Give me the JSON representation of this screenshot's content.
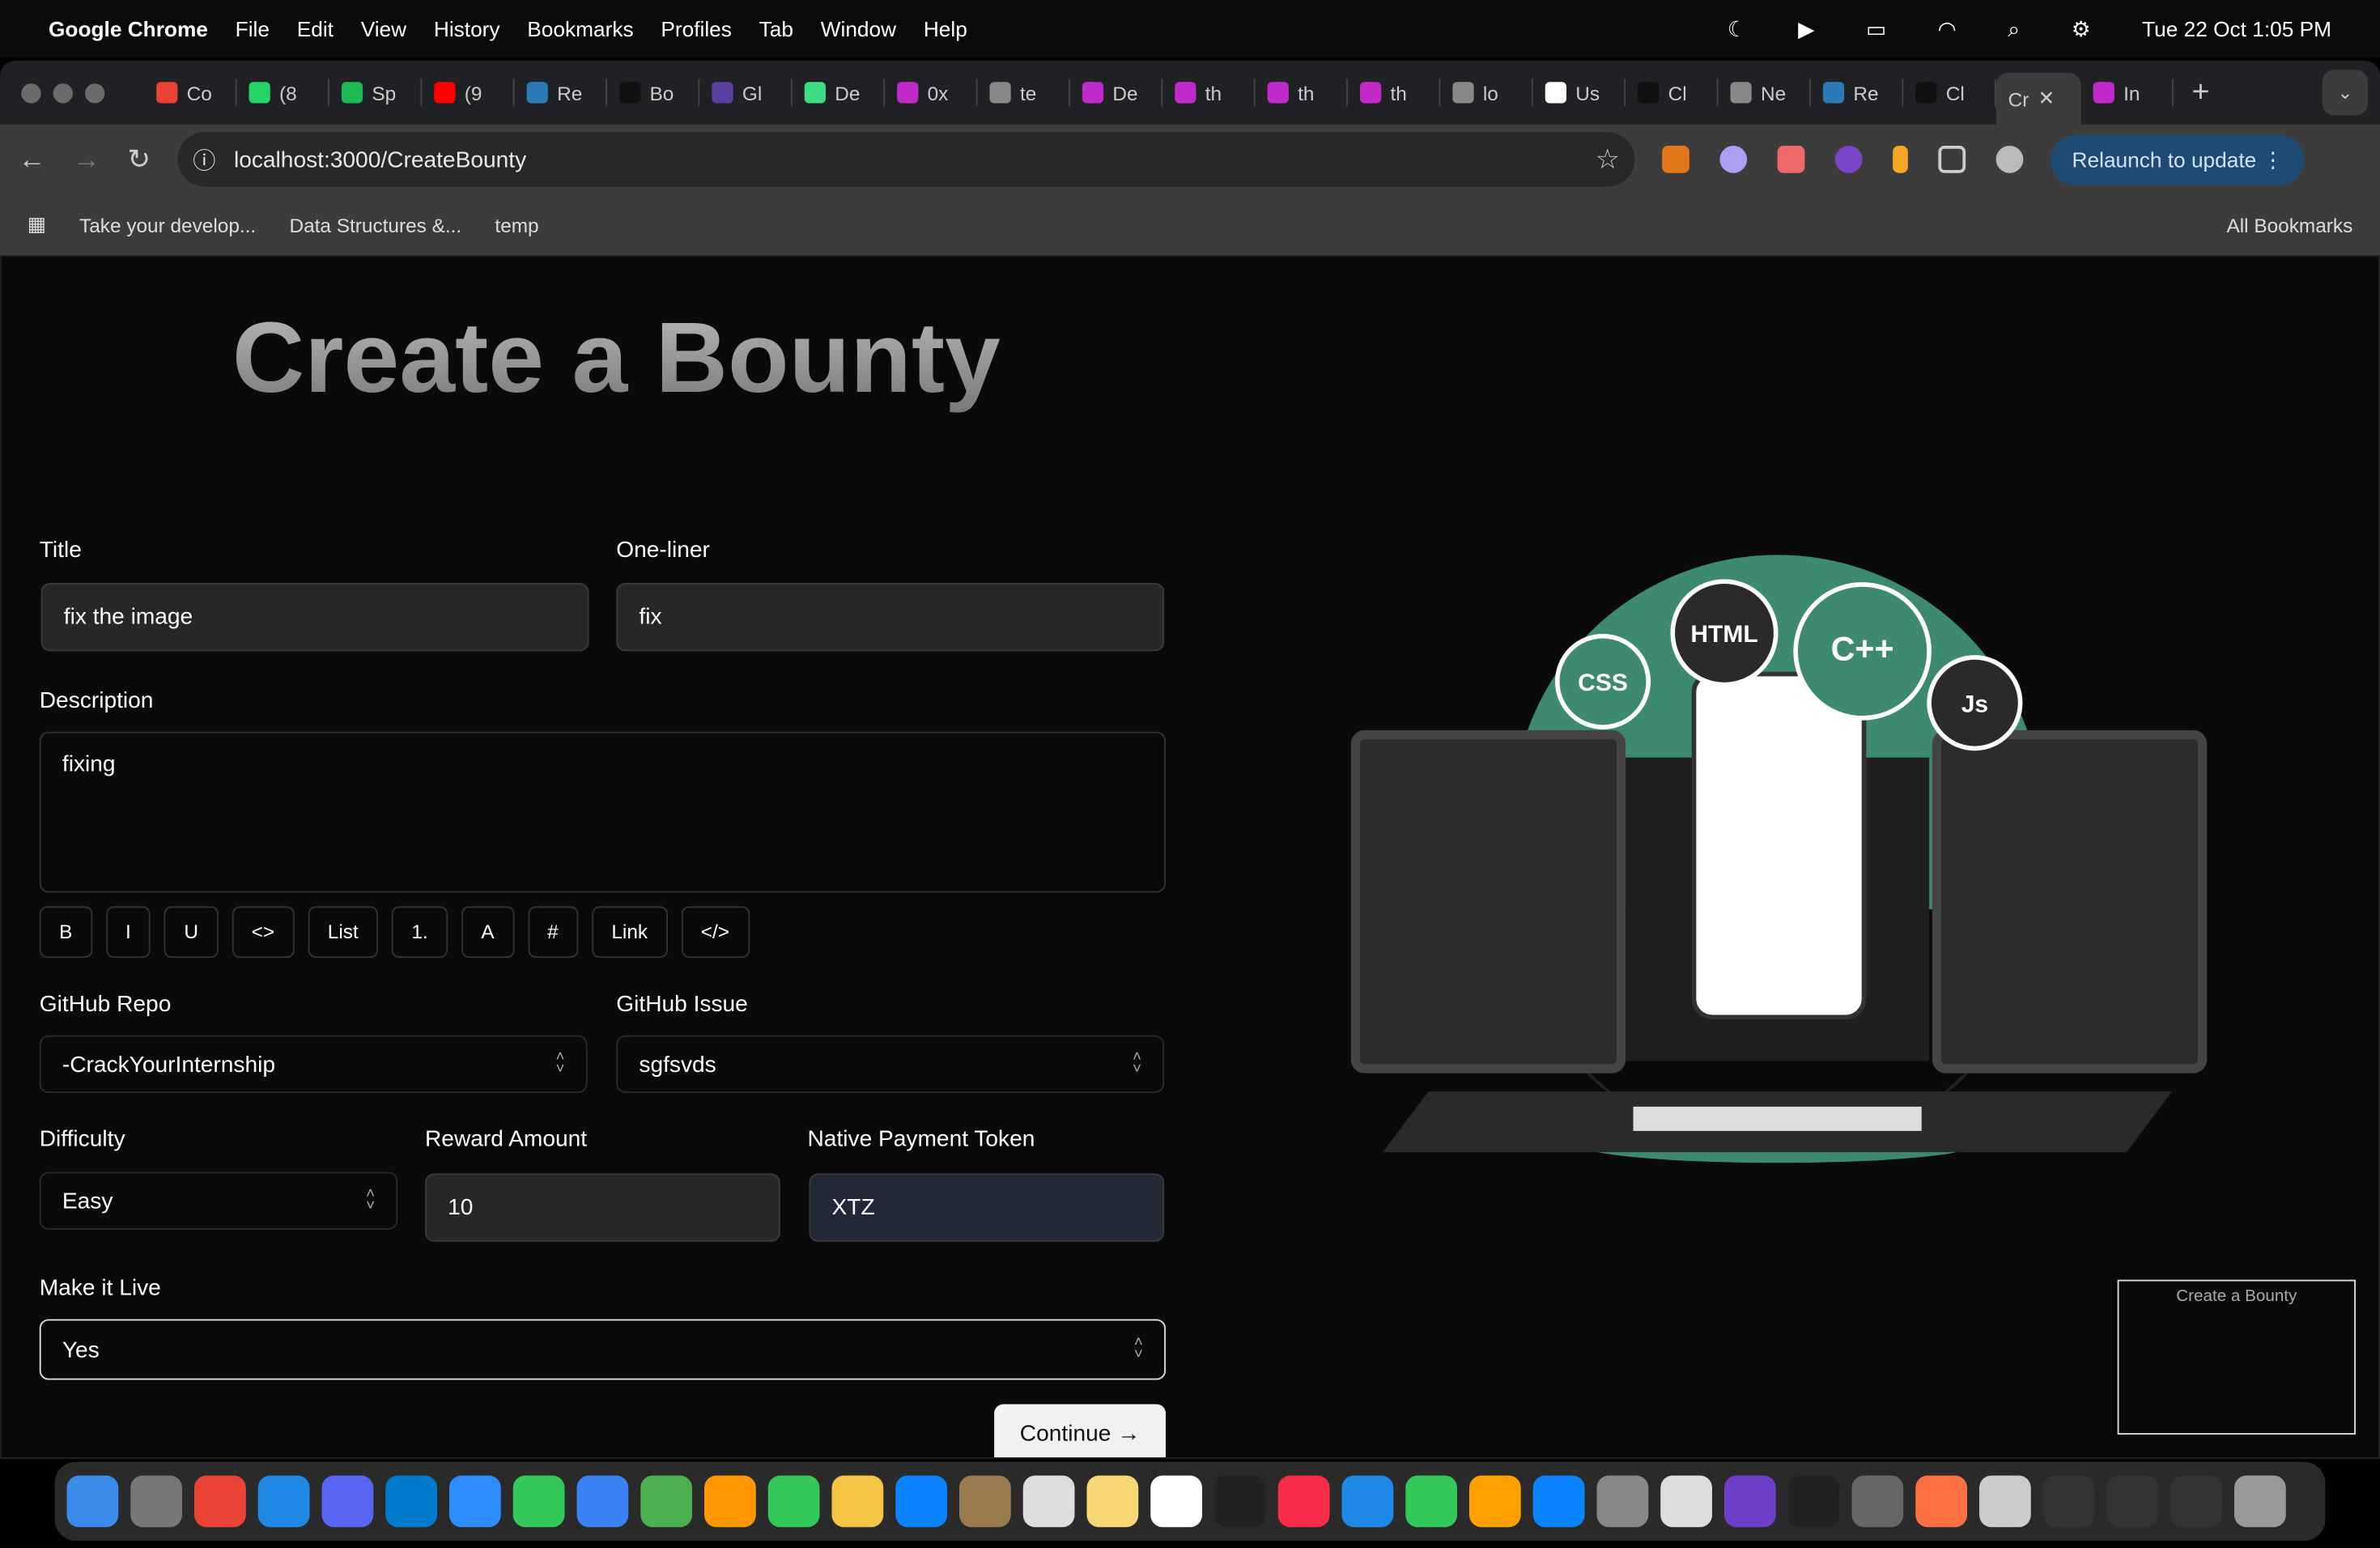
{
  "menubar": {
    "app": "Google Chrome",
    "items": [
      "File",
      "Edit",
      "View",
      "History",
      "Bookmarks",
      "Profiles",
      "Tab",
      "Window",
      "Help"
    ],
    "clock": "Tue 22 Oct  1:05 PM"
  },
  "tabs": [
    {
      "t": "Co",
      "c": "#ea4335"
    },
    {
      "t": "(8",
      "c": "#25d366"
    },
    {
      "t": "Sp",
      "c": "#1db954"
    },
    {
      "t": "(9",
      "c": "#ff0000"
    },
    {
      "t": "Re",
      "c": "#2a7ab5"
    },
    {
      "t": "Bo",
      "c": "#111"
    },
    {
      "t": "Gl",
      "c": "#5b3fa0"
    },
    {
      "t": "De",
      "c": "#3ddc84"
    },
    {
      "t": "0x",
      "c": "#c02ac9"
    },
    {
      "t": "te",
      "c": "#888"
    },
    {
      "t": "De",
      "c": "#c02ac9"
    },
    {
      "t": "th",
      "c": "#c02ac9"
    },
    {
      "t": "th",
      "c": "#c02ac9"
    },
    {
      "t": "th",
      "c": "#c02ac9"
    },
    {
      "t": "lo",
      "c": "#888"
    },
    {
      "t": "Us",
      "c": "#fff"
    },
    {
      "t": "Cl",
      "c": "#111"
    },
    {
      "t": "Ne",
      "c": "#888"
    },
    {
      "t": "Re",
      "c": "#2a7ab5"
    },
    {
      "t": "Cl",
      "c": "#111"
    }
  ],
  "active_tab": "Cr",
  "last_tab": "In",
  "url": "localhost:3000/CreateBounty",
  "relaunch": "Relaunch to update",
  "bookmarks": [
    "Take your develop...",
    "Data Structures &...",
    "temp"
  ],
  "all_bookmarks": "All Bookmarks",
  "form": {
    "heading": "Create a Bounty",
    "title_label": "Title",
    "title_value": "fix the image",
    "oneliner_label": "One-liner",
    "oneliner_value": "fix",
    "description_label": "Description",
    "description_value": "fixing",
    "format_buttons": [
      "B",
      "I",
      "U",
      "<>",
      "List",
      "1.",
      "A",
      "#",
      "Link",
      "</>"
    ],
    "repo_label": "GitHub Repo",
    "repo_value": "-CrackYourInternship",
    "issue_label": "GitHub Issue",
    "issue_value": "sgfsvds",
    "difficulty_label": "Difficulty",
    "difficulty_value": "Easy",
    "reward_label": "Reward Amount",
    "reward_value": "10",
    "token_label": "Native Payment Token",
    "token_value": "XTZ",
    "live_label": "Make it Live",
    "live_value": "Yes",
    "continue": "Continue →"
  },
  "illustration": {
    "badges": [
      "CSS",
      "HTML",
      "C++",
      "Js"
    ],
    "accent": "#3d8a6e"
  },
  "dock_colors": [
    "#3b8bea",
    "#777",
    "#ea4335",
    "#1e88e5",
    "#5865f2",
    "#007acc",
    "#2d8cff",
    "#34c759",
    "#3b82f6",
    "#4caf50",
    "#ff9800",
    "#34c759",
    "#f4c542",
    "#0a84ff",
    "#9a7b4f",
    "#ddd",
    "#f7d774",
    "#ffffff",
    "#222",
    "#fa2d48",
    "#1e88e5",
    "#34c759",
    "#ffa000",
    "#0a84ff",
    "#888",
    "#ddd",
    "#6e40c9",
    "#222",
    "#666",
    "#ff7043",
    "#ccc",
    "#333",
    "#333",
    "#333",
    "#999"
  ]
}
